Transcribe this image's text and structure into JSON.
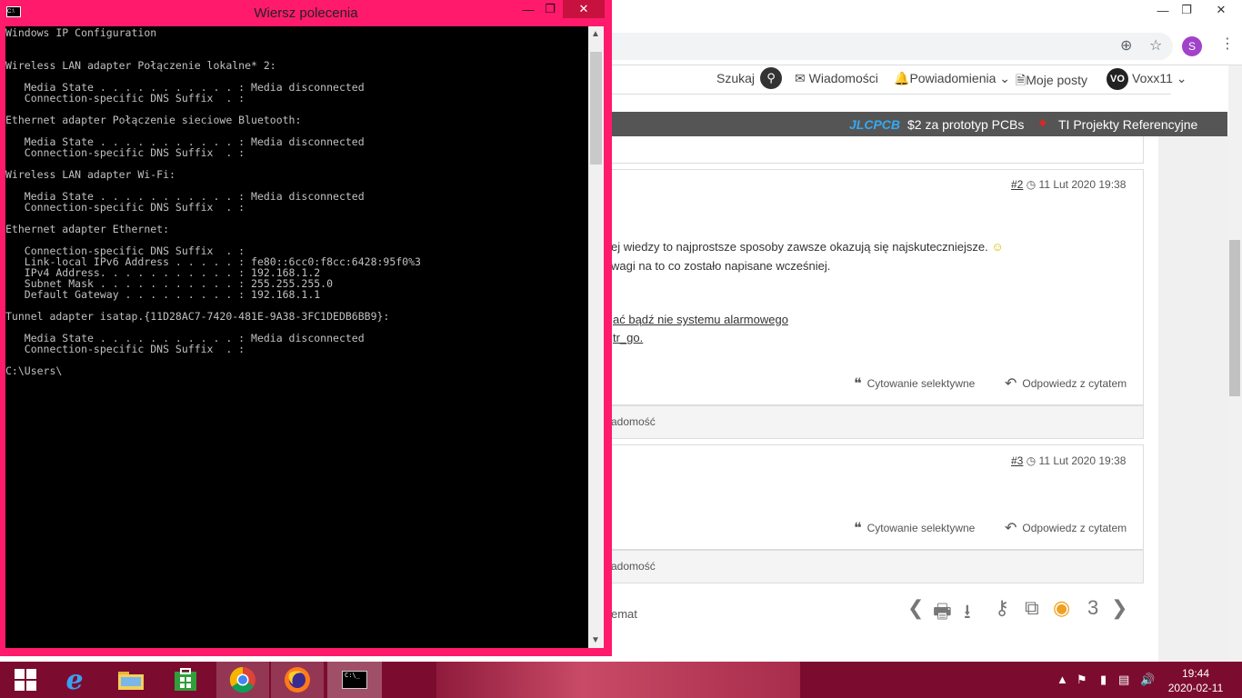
{
  "cmd": {
    "title": "Wiersz polecenia",
    "output": "Windows IP Configuration\n\n\nWireless LAN adapter Połączenie lokalne* 2:\n\n   Media State . . . . . . . . . . . : Media disconnected\n   Connection-specific DNS Suffix  . :\n\nEthernet adapter Połączenie sieciowe Bluetooth:\n\n   Media State . . . . . . . . . . . : Media disconnected\n   Connection-specific DNS Suffix  . :\n\nWireless LAN adapter Wi-Fi:\n\n   Media State . . . . . . . . . . . : Media disconnected\n   Connection-specific DNS Suffix  . :\n\nEthernet adapter Ethernet:\n\n   Connection-specific DNS Suffix  . :\n   Link-local IPv6 Address . . . . . : fe80::6cc0:f8cc:6428:95f0%3\n   IPv4 Address. . . . . . . . . . . : 192.168.1.2\n   Subnet Mask . . . . . . . . . . . : 255.255.255.0\n   Default Gateway . . . . . . . . . : 192.168.1.1\n\nTunnel adapter isatap.{11D28AC7-7420-481E-9A38-3FC1DEDB6BB9}:\n\n   Media State . . . . . . . . . . . : Media disconnected\n   Connection-specific DNS Suffix  . :\n\nC:\\Users\\"
  },
  "browser": {
    "profile_initial": "S"
  },
  "site_nav": {
    "search": "Szukaj",
    "messages": "Wiadomości",
    "notifications": "Powiadomienia",
    "my_posts": "Moje posty",
    "avatar": "VO",
    "user": "Voxx11"
  },
  "ads": {
    "jlc_brand": "JLCPCB",
    "jlc_text": "$2 za prototyp PCBs",
    "ti_text": "TI Projekty Referencyjne"
  },
  "posts": [
    {
      "num": "#2",
      "date": "11 Lut 2020 19:38",
      "line1": "ej wiedzy to najprostsze sposoby zawsze okazują się najskuteczniejsze.",
      "line2": "wagi na to co zostało napisane wcześniej.",
      "link1": "ać bądź nie systemu alarmowego",
      "link2": "tr_go.",
      "quote_sel": "Cytowanie selektywne",
      "reply_quote": "Odpowiedz z cytatem",
      "footer": "adomość"
    },
    {
      "num": "#3",
      "date": "11 Lut 2020 19:38",
      "quote_sel": "Cytowanie selektywne",
      "reply_quote": "Odpowiedz z cytatem",
      "footer": "adomość"
    }
  ],
  "bottom": {
    "topic": "emat",
    "views": "3"
  },
  "taskbar": {
    "time": "19:44",
    "date": "2020-02-11"
  },
  "colors": {
    "cmd_frame": "#ff1a6b",
    "taskbar": "#7c0c2f",
    "accent_views": "#f0a020"
  }
}
